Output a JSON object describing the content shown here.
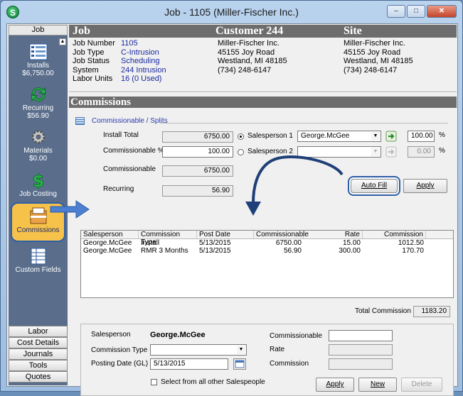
{
  "window": {
    "title": "Job - 1105 (Miller-Fischer Inc.)",
    "minimize": "–",
    "maximize": "□",
    "close": "✕",
    "app_icon": "S"
  },
  "sidebar": {
    "header": "Job",
    "scroll_arrow": "▲",
    "items": [
      {
        "label": "Installs",
        "sub": "$6,750.00",
        "icon": "installs-icon"
      },
      {
        "label": "Recurring",
        "sub": "$56.90",
        "icon": "recurring-icon"
      },
      {
        "label": "Materials",
        "sub": "$0.00",
        "icon": "gear-icon"
      },
      {
        "label": "Job Costing",
        "sub": "",
        "icon": "dollar-icon"
      },
      {
        "label": "Commissions",
        "sub": "",
        "icon": "commissions-icon"
      },
      {
        "label": "Custom Fields",
        "sub": "",
        "icon": "custom-fields-icon"
      }
    ],
    "bottom": [
      "Labor",
      "Cost Details",
      "Journals",
      "Tools",
      "Quotes"
    ]
  },
  "header": {
    "job": "Job",
    "customer": "Customer 244",
    "site": "Site"
  },
  "job_info": {
    "number_label": "Job Number",
    "number": "1105",
    "type_label": "Job Type",
    "type": "C-Intrusion",
    "status_label": "Job Status",
    "status": "Scheduling",
    "system_label": "System",
    "system": "244 Intrusion",
    "units_label": "Labor Units",
    "units": "16 (0 Used)"
  },
  "customer": {
    "name": "Miller-Fischer Inc.",
    "street": "45155 Joy Road",
    "city": "Westland, MI  48185",
    "phone": "(734) 248-6147"
  },
  "site": {
    "name": "Miller-Fischer Inc.",
    "street": "45155 Joy Road",
    "city": "Westland, MI  48185",
    "phone": "(734) 248-6147"
  },
  "commissions": {
    "title": "Commissions",
    "splits_label": "Commissionable / Splits",
    "install_total_label": "Install Total",
    "install_total": "6750.00",
    "commissionable_pct_label": "Commissionable %",
    "commissionable_pct": "100.00",
    "commissionable_label": "Commissionable",
    "commissionable": "6750.00",
    "recurring_label": "Recurring",
    "recurring": "56.90",
    "sp1_label": "Salesperson 1",
    "sp1_value": "George.McGee",
    "sp1_pct": "100.00",
    "sp2_label": "Salesperson 2",
    "sp2_value": "",
    "sp2_pct": "0.00",
    "pct_sign": "%",
    "auto_fill": "Auto Fill",
    "apply": "Apply",
    "columns": [
      "Salesperson",
      "Commission Type",
      "Post Date",
      "Commissionable",
      "Rate",
      "Commission"
    ],
    "rows": [
      [
        "George.McGee",
        "Install",
        "5/13/2015",
        "6750.00",
        "15.00",
        "1012.50"
      ],
      [
        "George.McGee",
        "RMR 3 Months",
        "5/13/2015",
        "56.90",
        "300.00",
        "170.70"
      ]
    ],
    "total_label": "Total Commission",
    "total": "1183.20"
  },
  "detail": {
    "salesperson_label": "Salesperson",
    "salesperson": "George.McGee",
    "type_label": "Commission Type",
    "type_value": "",
    "posting_date_label": "Posting Date (GL)",
    "posting_date": "5/13/2015",
    "commissionable_label": "Commissionable",
    "commissionable_value": "",
    "rate_label": "Rate",
    "rate_value": "",
    "commission_label": "Commission",
    "commission_value": "",
    "select_all_label": "Select from all other Salespeople",
    "apply": "Apply",
    "new": "New",
    "delete": "Delete"
  },
  "colors": {
    "sidebar_bg": "#5a6e8c",
    "header_bar": "#6d6d6d",
    "link_blue": "#1a2aa0",
    "highlight_blue": "#2d5ea8",
    "active_item": "#f7c24a"
  }
}
